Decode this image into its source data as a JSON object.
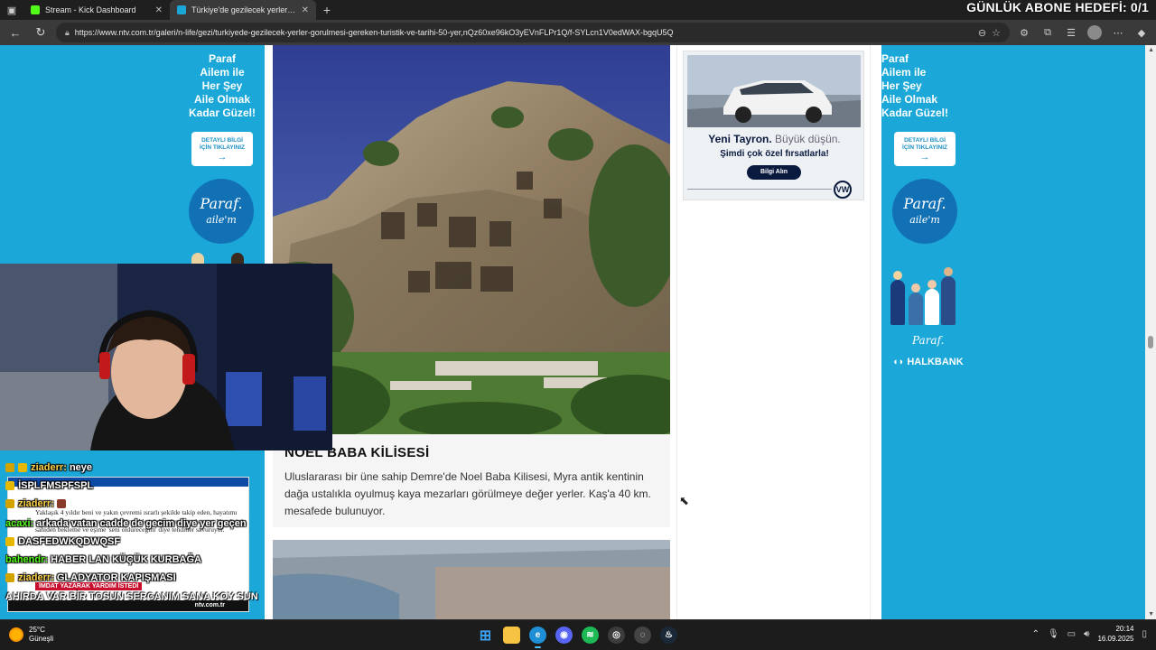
{
  "browser": {
    "tabs": [
      {
        "title": "Stream - Kick Dashboard",
        "favicon_color": "#53fc18",
        "active": false
      },
      {
        "title": "Türkiye'de gezilecek yerler: Görülmesi",
        "favicon_color": "#1ba7d8",
        "active": true
      }
    ],
    "new_tab_symbol": "+",
    "url": "https://www.ntv.com.tr/galeri/n-life/gezi/turkiyede-gezilecek-yerler-gorulmesi-gereken-turistik-ve-tarihi-50-yer,nQz60xe96kO3yEVnFLPr1Q/f-SYLcn1V0edWAX-bgqU5Q"
  },
  "stream_overlay": {
    "goal_text": "GÜNLÜK ABONE HEDEFİ: 0/1"
  },
  "ads": {
    "paraf": {
      "slogan_lines": [
        "Paraf",
        "Ailem ile",
        "Her Şey",
        "Aile Olmak",
        "Kadar Güzel!"
      ],
      "cta_lines": [
        "DETAYLI BİLGİ",
        "İÇİN TIKLAYINIZ"
      ],
      "cta_arrow": "→",
      "logo_main": "Paraf.",
      "logo_sub": "aile'm",
      "brand_small": "Paraf.",
      "bank": "HALKBANK"
    },
    "vw": {
      "headline_bold": "Yeni Tayron.",
      "headline_rest": "Büyük düşün.",
      "subline": "Şimdi çok özel fırsatlarla!",
      "button": "Bilgi Alın",
      "logo": "VW"
    }
  },
  "article": {
    "item_title": "NOEL BABA KİLİSESİ",
    "item_text": "Uluslararası bir üne sahip Demre'de Noel Baba Kilisesi, Myra antik kentinin dağa ustalıkla oyulmuş kaya mezarları görülmeye değer yerler. Kaş'a 40 km. mesafede bulunuyor."
  },
  "chat": {
    "lines": [
      {
        "user": "ziaderr:",
        "message": "neye",
        "color": "yellow"
      },
      {
        "user": "",
        "message": "İSPLFMSPFSPL",
        "color": "yellow"
      },
      {
        "user": "ziaderr:",
        "message": "",
        "color": "yellow"
      },
      {
        "user": "acaxi:",
        "message": "arkada vatan cadde de gecim diye yer geçen",
        "color": "green"
      },
      {
        "user": "",
        "message": "DASFEDWKQDWQSF",
        "color": "yellow"
      },
      {
        "user": "bahendr:",
        "message": "HABER LAN KÜÇÜK KURBAĞA",
        "color": "green"
      },
      {
        "user": "ziaderr:",
        "message": "GLADYATOR KAPIŞMASI",
        "color": "yellow"
      }
    ],
    "bottom_line": "AHIRDA VAR BİR TOSUN SERCANIM SANA KOY SUN",
    "news_card": {
      "body": "Yaklaşık 4 yıldır beni ve yakın çevremi ısrarlı şekilde takip eden, hayatımı çekilmez hale getiren ve beni öldürmekle tehdit eden bir şahıs var. Kendisini sahiden bekleme ve eşime 'seni öldüreceğim' diye tehditler savuruyor.",
      "tag": "İMDAT YAZARAK YARDIM İSTEDİ",
      "source": "ntv.com.tr"
    }
  },
  "taskbar": {
    "weather_temp": "25°C",
    "weather_desc": "Güneşli",
    "time": "20:14",
    "date": "16.09.2025",
    "apps": [
      {
        "name": "windows-start",
        "color": "#3ba3f5",
        "glyph": "⊞"
      },
      {
        "name": "file-explorer",
        "color": "#f5c242",
        "glyph": "▬"
      },
      {
        "name": "edge-browser",
        "color": "#1f8fd6",
        "glyph": "e"
      },
      {
        "name": "discord",
        "color": "#5865f2",
        "glyph": "◉"
      },
      {
        "name": "spotify",
        "color": "#1db954",
        "glyph": "≋"
      },
      {
        "name": "obs-studio",
        "color": "#3c3c3c",
        "glyph": "◎"
      },
      {
        "name": "chrome-app",
        "color": "#444444",
        "glyph": "◌"
      },
      {
        "name": "steam",
        "color": "#1b2838",
        "glyph": "♨"
      }
    ]
  }
}
